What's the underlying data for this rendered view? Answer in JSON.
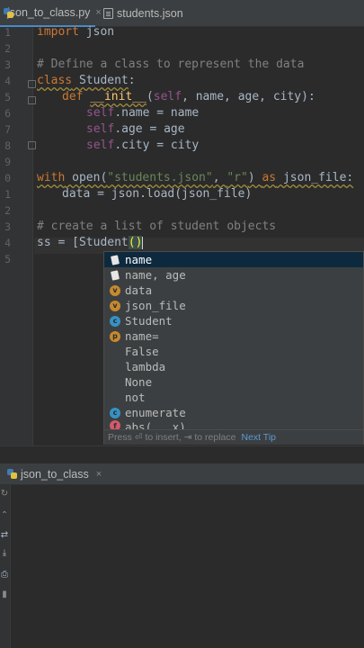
{
  "tabs": [
    {
      "label": "json_to_class.py",
      "close": "×"
    },
    {
      "label": "students.json"
    }
  ],
  "line_numbers": [
    "1",
    "2",
    "3",
    "4",
    "5",
    "6",
    "7",
    "8",
    "9",
    "0",
    "1",
    "2",
    "3",
    "4",
    "5"
  ],
  "code": {
    "l1_kw": "import",
    "l1_rest": " json",
    "l3": "# Define a class to represent the data",
    "l4_kw": "class",
    "l4_name": " Student",
    "l4_end": ":",
    "l5_kw": "def",
    "l5_sp": " ",
    "l5_init": "__init__",
    "l5_open": "(",
    "l5_self": "self",
    "l5_rest": ", name, age, city):",
    "l6_self": "self",
    "l6_rest": ".name = name",
    "l7_self": "self",
    "l7_rest": ".age = age",
    "l8_self": "self",
    "l8_rest": ".city = city",
    "l10_kw": "with",
    "l10_open": " open(",
    "l10_s1": "\"students.json\"",
    "l10_comma": ", ",
    "l10_s2": "\"r\"",
    "l10_close": ") ",
    "l10_as": "as",
    "l10_rest": " json_file:",
    "l11": "data = json.load(json_file)",
    "l13": "# create a list of student objects",
    "l14_pre": "ss = [Student",
    "l14_parens": "()"
  },
  "completion": {
    "items": [
      {
        "icon": "param",
        "label": "name"
      },
      {
        "icon": "param",
        "label": "name, age"
      },
      {
        "icon": "v",
        "label": "data"
      },
      {
        "icon": "v",
        "label": "json_file"
      },
      {
        "icon": "c",
        "label": "Student"
      },
      {
        "icon": "p",
        "label": "name="
      },
      {
        "icon": "blank",
        "label": "False"
      },
      {
        "icon": "blank",
        "label": "lambda"
      },
      {
        "icon": "blank",
        "label": "None"
      },
      {
        "icon": "blank",
        "label": "not"
      },
      {
        "icon": "c",
        "label": "enumerate"
      },
      {
        "icon": "f",
        "label": "abs(...x)"
      }
    ],
    "footer": "Press ⏎ to insert, ⇥ to replace",
    "next_tip": "Next Tip"
  },
  "run": {
    "label": "json_to_class",
    "close": "×"
  },
  "colors": {
    "keyword": "#cc7832",
    "comment": "#808080",
    "string": "#6a8759",
    "self": "#94558d",
    "selection": "#0d293e"
  }
}
